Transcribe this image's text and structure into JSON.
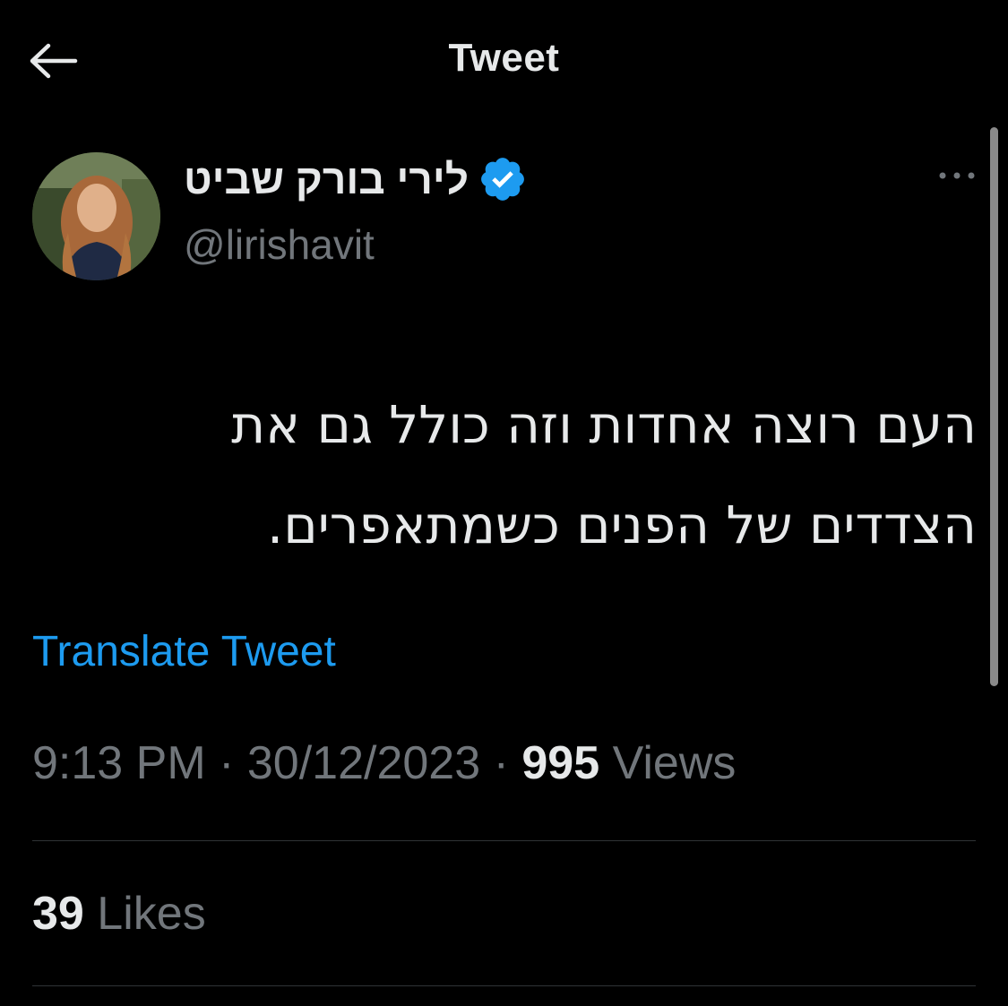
{
  "header": {
    "title": "Tweet",
    "back_icon": "arrow-left-icon"
  },
  "author": {
    "display_name": "לירי בורק שביט",
    "handle": "@lirishavit",
    "verified_icon": "verified-badge-icon",
    "verified_color": "#1d9bf0"
  },
  "tweet": {
    "line1": "העם רוצה אחדות וזה כולל גם את",
    "line2": "הצדדים של הפנים כשמתאפרים.",
    "translate_label": "Translate Tweet"
  },
  "meta": {
    "time": "9:13 PM",
    "separator": "·",
    "date": "30/12/2023",
    "views_count": "995",
    "views_label": "Views"
  },
  "engagement": {
    "likes_count": "39",
    "likes_label": "Likes"
  },
  "colors": {
    "background": "#000000",
    "text_primary": "#e7e9ea",
    "text_secondary": "#71767b",
    "link": "#1d9bf0",
    "divider": "#2f3336"
  }
}
